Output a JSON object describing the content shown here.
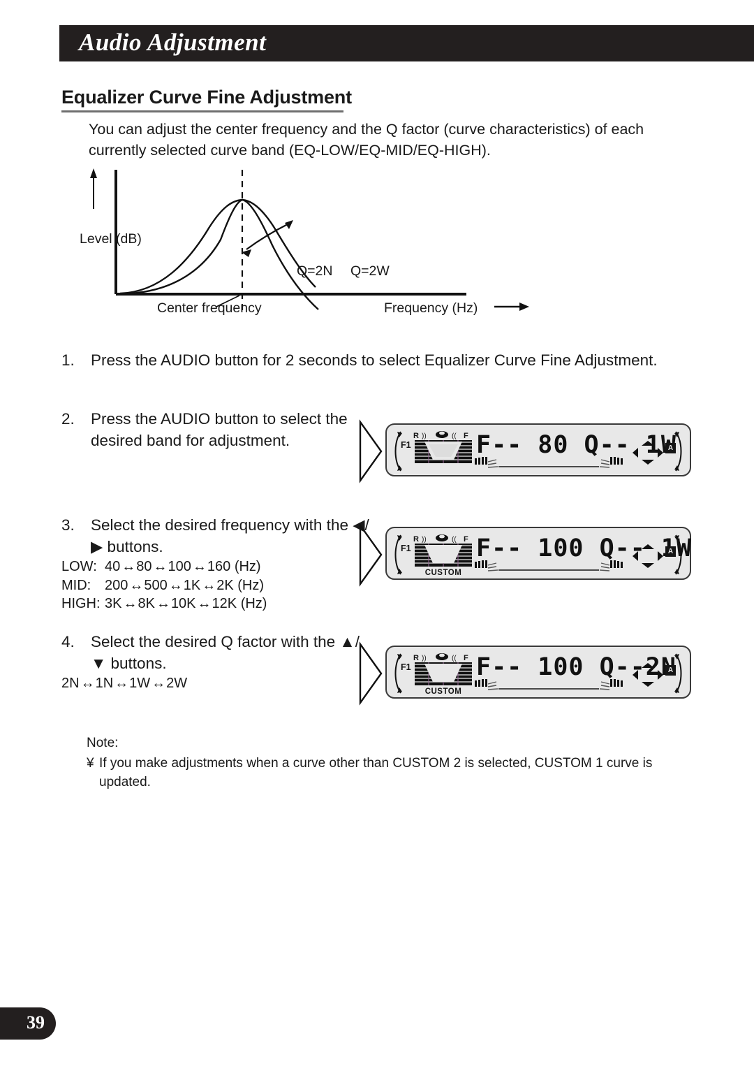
{
  "header": {
    "title": "Audio Adjustment"
  },
  "section": {
    "heading": "Equalizer Curve Fine Adjustment",
    "intro": "You can adjust the center frequency and the Q factor (curve characteristics) of each currently selected curve band (EQ-LOW/EQ-MID/EQ-HIGH)."
  },
  "figure": {
    "y_axis_label": "Level (dB)",
    "x_axis_label": "Frequency (Hz)",
    "center_label": "Center frequency",
    "curve_narrow_label": "Q=2N",
    "curve_wide_label": "Q=2W"
  },
  "steps": [
    {
      "number": "1.",
      "text": "Press the AUDIO button for 2 seconds to select Equalizer Curve Fine Adjustment."
    },
    {
      "number": "2.",
      "text": "Press the AUDIO button to select the desired band for adjustment."
    },
    {
      "number": "3.",
      "text": "Select the desired frequency with the ◀/▶ buttons.",
      "bands": [
        {
          "tag": "LOW:",
          "values": [
            "40",
            "80",
            "100",
            "160"
          ],
          "unit": "(Hz)"
        },
        {
          "tag": "MID:",
          "values": [
            "200",
            "500",
            "1K",
            "2K"
          ],
          "unit": "(Hz)"
        },
        {
          "tag": "HIGH:",
          "values": [
            "3K",
            "8K",
            "10K",
            "12K"
          ],
          "unit": "(Hz)"
        }
      ]
    },
    {
      "number": "4.",
      "text": "Select the desired Q factor with the ▲/▼ buttons.",
      "q_values": [
        "2N",
        "1N",
        "1W",
        "2W"
      ]
    }
  ],
  "displays": [
    {
      "readout": "F-- 80 Q-- 1W",
      "f1_label": "F1",
      "rear_label": "R",
      "front_label": "F",
      "custom_label": "",
      "badge": "A"
    },
    {
      "readout": "F-- 100 Q-- 1W",
      "f1_label": "F1",
      "rear_label": "R",
      "front_label": "F",
      "custom_label": "CUSTOM",
      "badge": "A"
    },
    {
      "readout": "F-- 100 Q--2N",
      "f1_label": "F1",
      "rear_label": "R",
      "front_label": "F",
      "custom_label": "CUSTOM",
      "badge": "A"
    }
  ],
  "note": {
    "title": "Note:",
    "bullet": "¥",
    "line1": "If you make adjustments when a curve other than  CUSTOM 2  is selected,  CUSTOM 1  curve is",
    "line2": "updated."
  },
  "footer": {
    "page_number": "39"
  },
  "arrows": {
    "double": "↔"
  }
}
